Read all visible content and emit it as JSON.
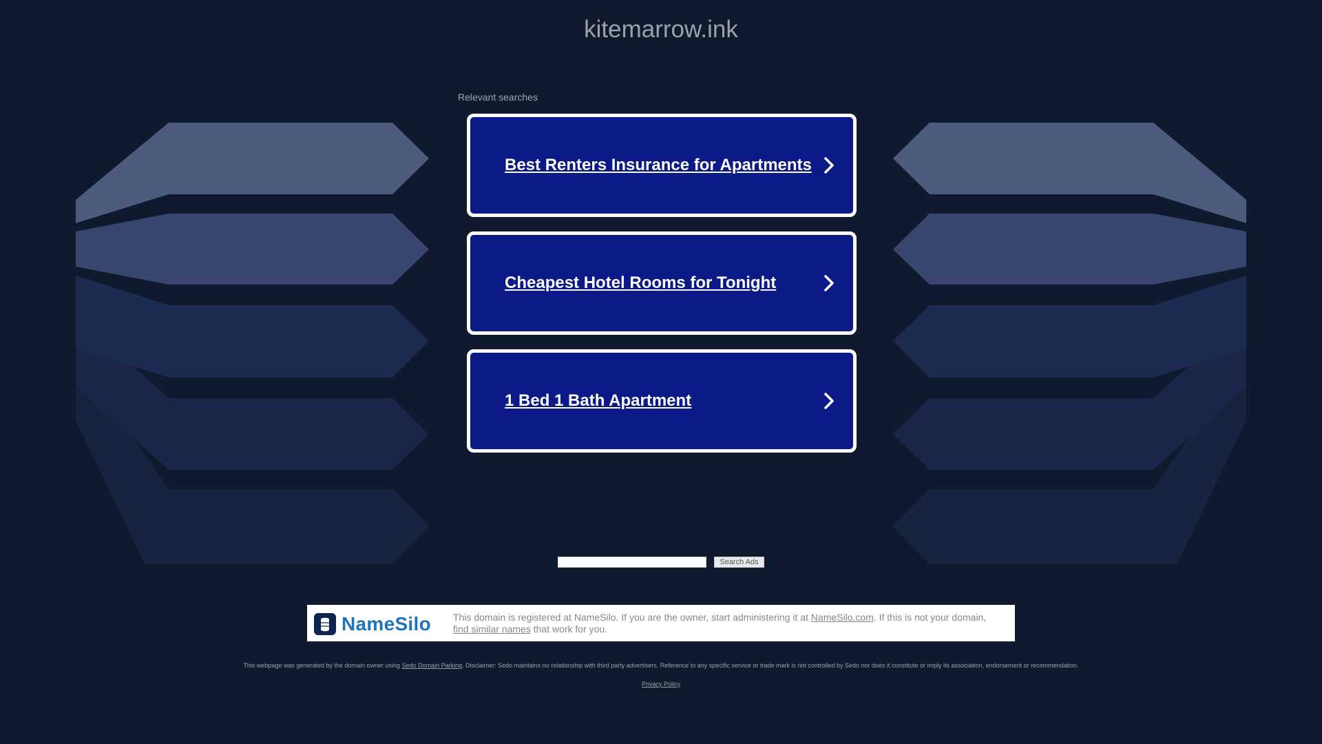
{
  "domain": "kitemarrow.ink",
  "relevant_searches_label": "Relevant searches",
  "ads": [
    {
      "label": "Best Renters Insurance for Apartments"
    },
    {
      "label": "Cheapest Hotel Rooms for Tonight"
    },
    {
      "label": "1 Bed 1 Bath Apartment"
    }
  ],
  "search": {
    "value": "",
    "button_label": "Search Ads"
  },
  "registrar": {
    "logo_text": "NameSilo",
    "text_1": "This domain is registered at NameSilo. If you are the owner, start administering it at ",
    "link_1": "NameSilo.com",
    "text_2": ". If this is not your domain, ",
    "link_2": "find similar names",
    "text_3": " that work for you."
  },
  "disclaimer": {
    "text_1": "This webpage was generated by the domain owner using ",
    "link": "Sedo Domain Parking",
    "text_2": ". Disclaimer: Sedo maintains no relationship with third party advertisers. Reference to any specific service or trade mark is not controlled by Sedo nor does it constitute or imply its association, endorsement or recommendation."
  },
  "privacy_policy": "Privacy Policy",
  "colors": {
    "background": "#0f1a2e",
    "card_fill": "#0b1a87",
    "card_border": "#ffffff",
    "brand_blue": "#1c75bc"
  },
  "icons": {
    "chevron": "chevron-right-icon",
    "logo": "namesilo-logo-icon"
  }
}
